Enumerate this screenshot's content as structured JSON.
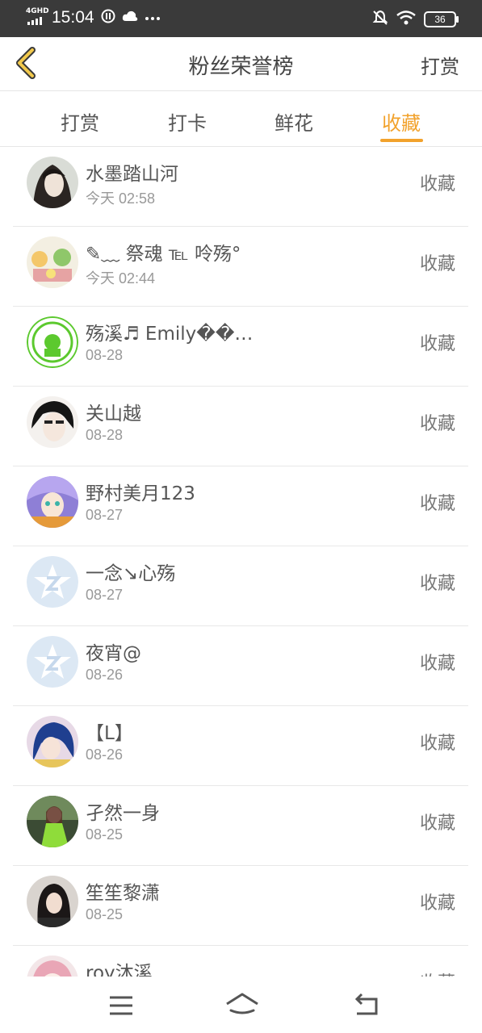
{
  "status_bar": {
    "network": "4GHD",
    "time": "15:04",
    "battery": "36",
    "icons": [
      "signal-icon",
      "data-saver-icon",
      "cloud-icon",
      "more-dots-icon",
      "mute-icon",
      "wifi-icon",
      "battery-icon"
    ]
  },
  "header": {
    "title": "粉丝荣誉榜",
    "right_action": "打赏"
  },
  "tabs": [
    {
      "label": "打赏",
      "active": false
    },
    {
      "label": "打卡",
      "active": false
    },
    {
      "label": "鲜花",
      "active": false
    },
    {
      "label": "收藏",
      "active": true
    }
  ],
  "accent_color": "#f2a22c",
  "fans": [
    {
      "name": "水墨踏山河",
      "time": "今天 02:58",
      "action": "收藏"
    },
    {
      "name": "✎﹏ 祭魂 ℡ 呤殇°",
      "time": "今天 02:44",
      "action": "收藏"
    },
    {
      "name": "殇溪♬ Emily��…",
      "time": "08-28",
      "action": "收藏"
    },
    {
      "name": "关山越",
      "time": "08-28",
      "action": "收藏"
    },
    {
      "name": "野村美月123",
      "time": "08-27",
      "action": "收藏"
    },
    {
      "name": "一念↘心殇",
      "time": "08-27",
      "action": "收藏"
    },
    {
      "name": "夜宵@",
      "time": "08-26",
      "action": "收藏"
    },
    {
      "name": "【L】",
      "time": "08-26",
      "action": "收藏"
    },
    {
      "name": "孑然一身",
      "time": "08-25",
      "action": "收藏"
    },
    {
      "name": "笙笙黎潇",
      "time": "08-25",
      "action": "收藏"
    },
    {
      "name": "roy沐溪",
      "time": "",
      "action": "收藏"
    }
  ],
  "nav_bar": {
    "icons": [
      "menu-icon",
      "home-icon",
      "back-icon"
    ]
  }
}
